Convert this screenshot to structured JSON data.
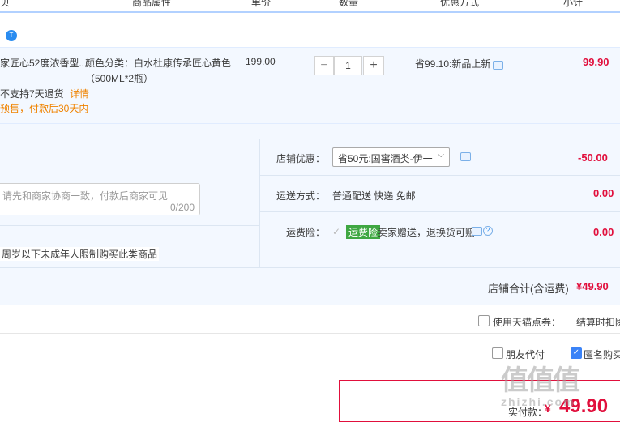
{
  "header": {
    "columns": [
      "贝",
      "商品属性",
      "单价",
      "数量",
      "优惠方式",
      "小计"
    ]
  },
  "shop": {
    "badge": "T"
  },
  "item": {
    "title": "家匠心52度浓香型...",
    "attr_line1": "颜色分类：白水杜康传承匠心黄色",
    "attr_line2": "（500ML*2瓶）",
    "unit_price": "199.00",
    "quantity": "1",
    "qty_minus": "−",
    "qty_plus": "+",
    "discount": "省99.10:新品上新",
    "subtotal": "99.90",
    "return_note": "不支持7天退货",
    "return_link": "详情",
    "presale_note": "预售，付款后30天内"
  },
  "options": {
    "shop_discount_label": "店铺优惠：",
    "shop_discount_select": "省50元:国窖酒类-伊一",
    "shop_discount_value": "-50.00",
    "shipping_label": "运送方式：",
    "shipping_value": "普通配送 快递 免邮",
    "shipping_price": "0.00",
    "insurance_label": "运费险：",
    "insurance_badge": "运费险",
    "insurance_text": "卖家赠送，退换货可赔",
    "insurance_price": "0.00",
    "message_placeholder": "请先和商家协商一致，付款后商家可见",
    "message_count": "0/200",
    "age_notice": "周岁以下未成年人限制购买此类商品"
  },
  "shop_total": {
    "label": "店铺合计(含运费)",
    "value": "¥49.90"
  },
  "points": {
    "label": "使用天猫点券：",
    "note": "结算时扣除"
  },
  "pay_options": {
    "friend_pay": "朋友代付",
    "anonymous": "匿名购买"
  },
  "final": {
    "label": "实付款：",
    "currency": "¥",
    "value": "49.90"
  },
  "watermark": {
    "logo": "值值值",
    "site": "zhizhi.com"
  }
}
